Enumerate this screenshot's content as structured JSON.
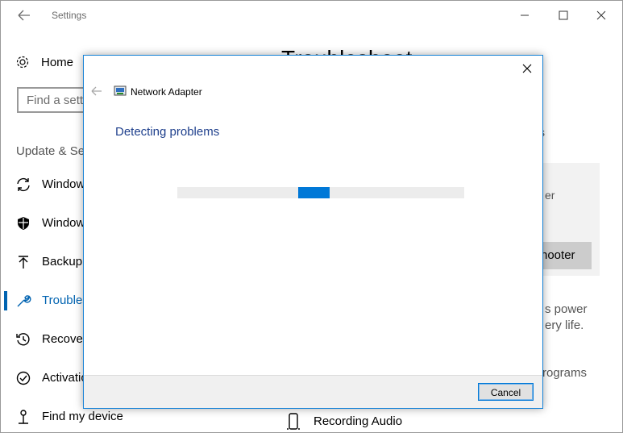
{
  "window": {
    "title": "Settings",
    "controls": [
      "minimize",
      "maximize",
      "close"
    ]
  },
  "sidebar": {
    "home_label": "Home",
    "search_placeholder": "Find a setting",
    "section_label": "Update & Security",
    "items": [
      {
        "label": "Windows Update",
        "icon": "sync-icon"
      },
      {
        "label": "Windows Defender",
        "icon": "shield-icon"
      },
      {
        "label": "Backup",
        "icon": "upload-arrow-icon"
      },
      {
        "label": "Troubleshoot",
        "icon": "wrench-icon",
        "active": true
      },
      {
        "label": "Recovery",
        "icon": "history-icon"
      },
      {
        "label": "Activation",
        "icon": "check-circle-icon"
      },
      {
        "label": "Find my device",
        "icon": "person-pin-icon"
      }
    ]
  },
  "main": {
    "title": "Troubleshoot",
    "panel_text": "er",
    "run_button_label": "hooter",
    "power_text": "s power\nery life.",
    "programs_text": "rograms",
    "status_glyph": "s",
    "recording_audio_label": "Recording Audio"
  },
  "dialog": {
    "app_name": "Network Adapter",
    "heading": "Detecting problems",
    "cancel_label": "Cancel"
  },
  "colors": {
    "accent": "#0078d7",
    "heading_blue": "#1e3f8c",
    "progress_track": "#ececec"
  }
}
